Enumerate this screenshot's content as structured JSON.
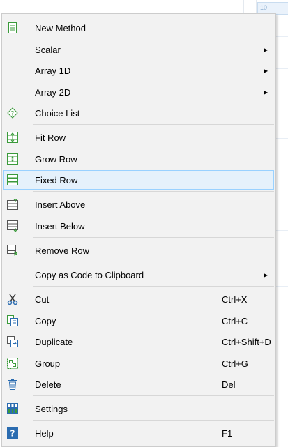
{
  "background": {
    "cell_label": "10"
  },
  "menu": {
    "items": [
      {
        "label": "New Method",
        "icon": "new-method-icon"
      },
      {
        "label": "Scalar",
        "submenu": true
      },
      {
        "label": "Array 1D",
        "submenu": true
      },
      {
        "label": "Array 2D",
        "submenu": true
      },
      {
        "label": "Choice List",
        "icon": "choice-list-icon"
      },
      {
        "label": "Fit Row",
        "icon": "fit-row-icon"
      },
      {
        "label": "Grow Row",
        "icon": "grow-row-icon"
      },
      {
        "label": "Fixed Row",
        "icon": "fixed-row-icon",
        "highlighted": true
      },
      {
        "label": "Insert Above",
        "icon": "insert-above-icon"
      },
      {
        "label": "Insert Below",
        "icon": "insert-below-icon"
      },
      {
        "label": "Remove Row",
        "icon": "remove-row-icon"
      },
      {
        "label": "Copy as Code to Clipboard",
        "submenu": true
      },
      {
        "label": "Cut",
        "shortcut": "Ctrl+X",
        "icon": "cut-icon"
      },
      {
        "label": "Copy",
        "shortcut": "Ctrl+C",
        "icon": "copy-icon"
      },
      {
        "label": "Duplicate",
        "shortcut": "Ctrl+Shift+D",
        "icon": "duplicate-icon"
      },
      {
        "label": "Group",
        "shortcut": "Ctrl+G",
        "icon": "group-icon"
      },
      {
        "label": "Delete",
        "shortcut": "Del",
        "icon": "delete-icon"
      },
      {
        "label": "Settings",
        "icon": "settings-icon"
      },
      {
        "label": "Help",
        "shortcut": "F1",
        "icon": "help-icon"
      }
    ]
  },
  "colors": {
    "menu_bg": "#f2f2f2",
    "highlight_bg": "#e5f1fb",
    "highlight_border": "#99d1ff",
    "icon_green": "#3a9a3a",
    "icon_blue": "#2b6cb0"
  }
}
